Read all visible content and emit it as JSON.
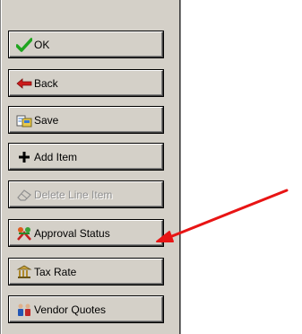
{
  "buttons": [
    {
      "label": "OK",
      "icon": "checkmark-icon",
      "enabled": true
    },
    {
      "label": "Back",
      "icon": "back-arrow-icon",
      "enabled": true
    },
    {
      "label": "Save",
      "icon": "save-icon",
      "enabled": true
    },
    {
      "label": "Add Item",
      "icon": "plus-icon",
      "enabled": true
    },
    {
      "label": "Delete Line Item",
      "icon": "eraser-icon",
      "enabled": false
    },
    {
      "label": "Approval Status",
      "icon": "approval-icon",
      "enabled": true
    },
    {
      "label": "Tax Rate",
      "icon": "tax-building-icon",
      "enabled": true
    },
    {
      "label": "Vendor Quotes",
      "icon": "people-icon",
      "enabled": true
    }
  ],
  "colors": {
    "panel": "#d4d0c8",
    "annotation_arrow": "#e81414",
    "ok_check": "#1fa51f",
    "back_arrow": "#cc1b1b"
  }
}
